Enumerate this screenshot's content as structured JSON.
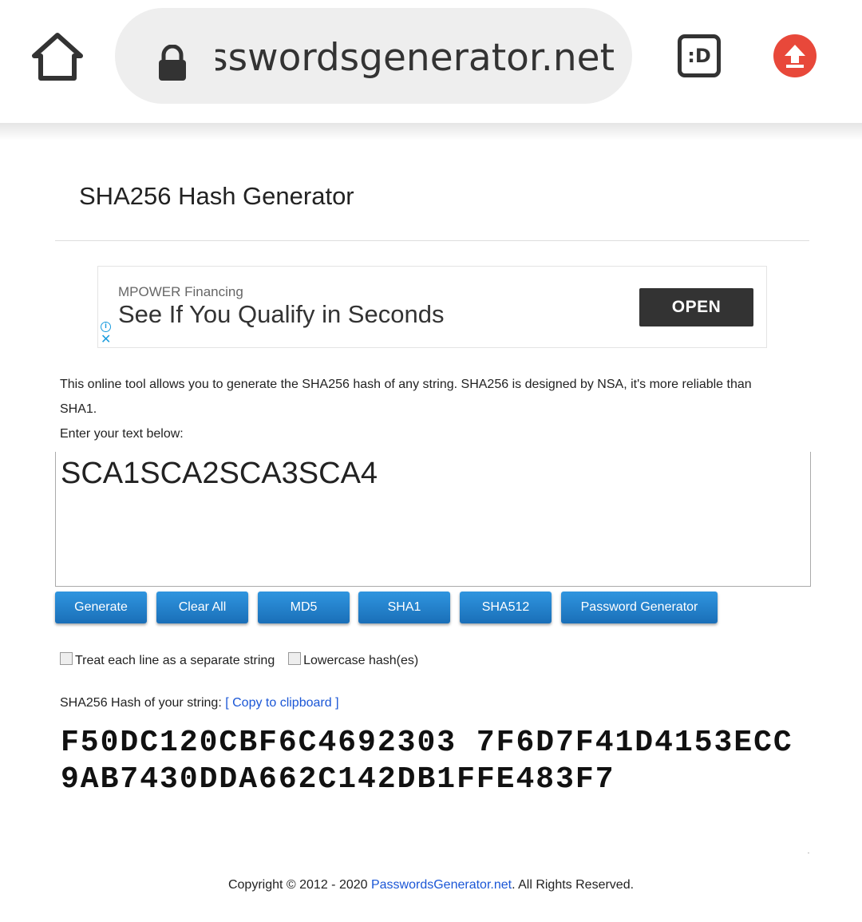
{
  "browser": {
    "url": "passwordsgenerator.net",
    "tabs_label": ":D",
    "icons": {
      "home": "home-icon",
      "lock": "lock-icon",
      "upload": "arrow-up-icon"
    },
    "upload_color": "#e8483a"
  },
  "page": {
    "title": "SHA256 Hash Generator"
  },
  "ad": {
    "sponsor": "MPOWER Financing",
    "headline": "See If You Qualify in Seconds",
    "cta": "OPEN",
    "info_icon": "info-icon",
    "close_icon": "close-icon"
  },
  "tool": {
    "description": "This online tool allows you to generate the SHA256 hash of any string. SHA256 is designed by NSA, it's more reliable than SHA1.",
    "enter_label": "Enter your text below:",
    "input_value": "SCA1SCA2SCA3SCA4",
    "buttons": {
      "generate": "Generate",
      "clear": "Clear All",
      "md5": "MD5",
      "sha1": "SHA1",
      "sha512": "SHA512",
      "password": "Password Generator"
    },
    "button_color": "#1a7fd0",
    "options": {
      "separate_lines": "Treat each line as a separate string",
      "lowercase": "Lowercase hash(es)"
    },
    "hash_label": "SHA256 Hash of your string:",
    "copy_link": "[ Copy to clipboard ]",
    "hash_value": "F50DC120CBF6C4692303 7F6D7F41D4153ECC9AB7430DDA662C142DB1FFE483F7"
  },
  "footer": {
    "prefix": "Copyright © 2012 - 2020 ",
    "link": "PasswordsGenerator.net",
    "suffix": ". All Rights Reserved."
  }
}
